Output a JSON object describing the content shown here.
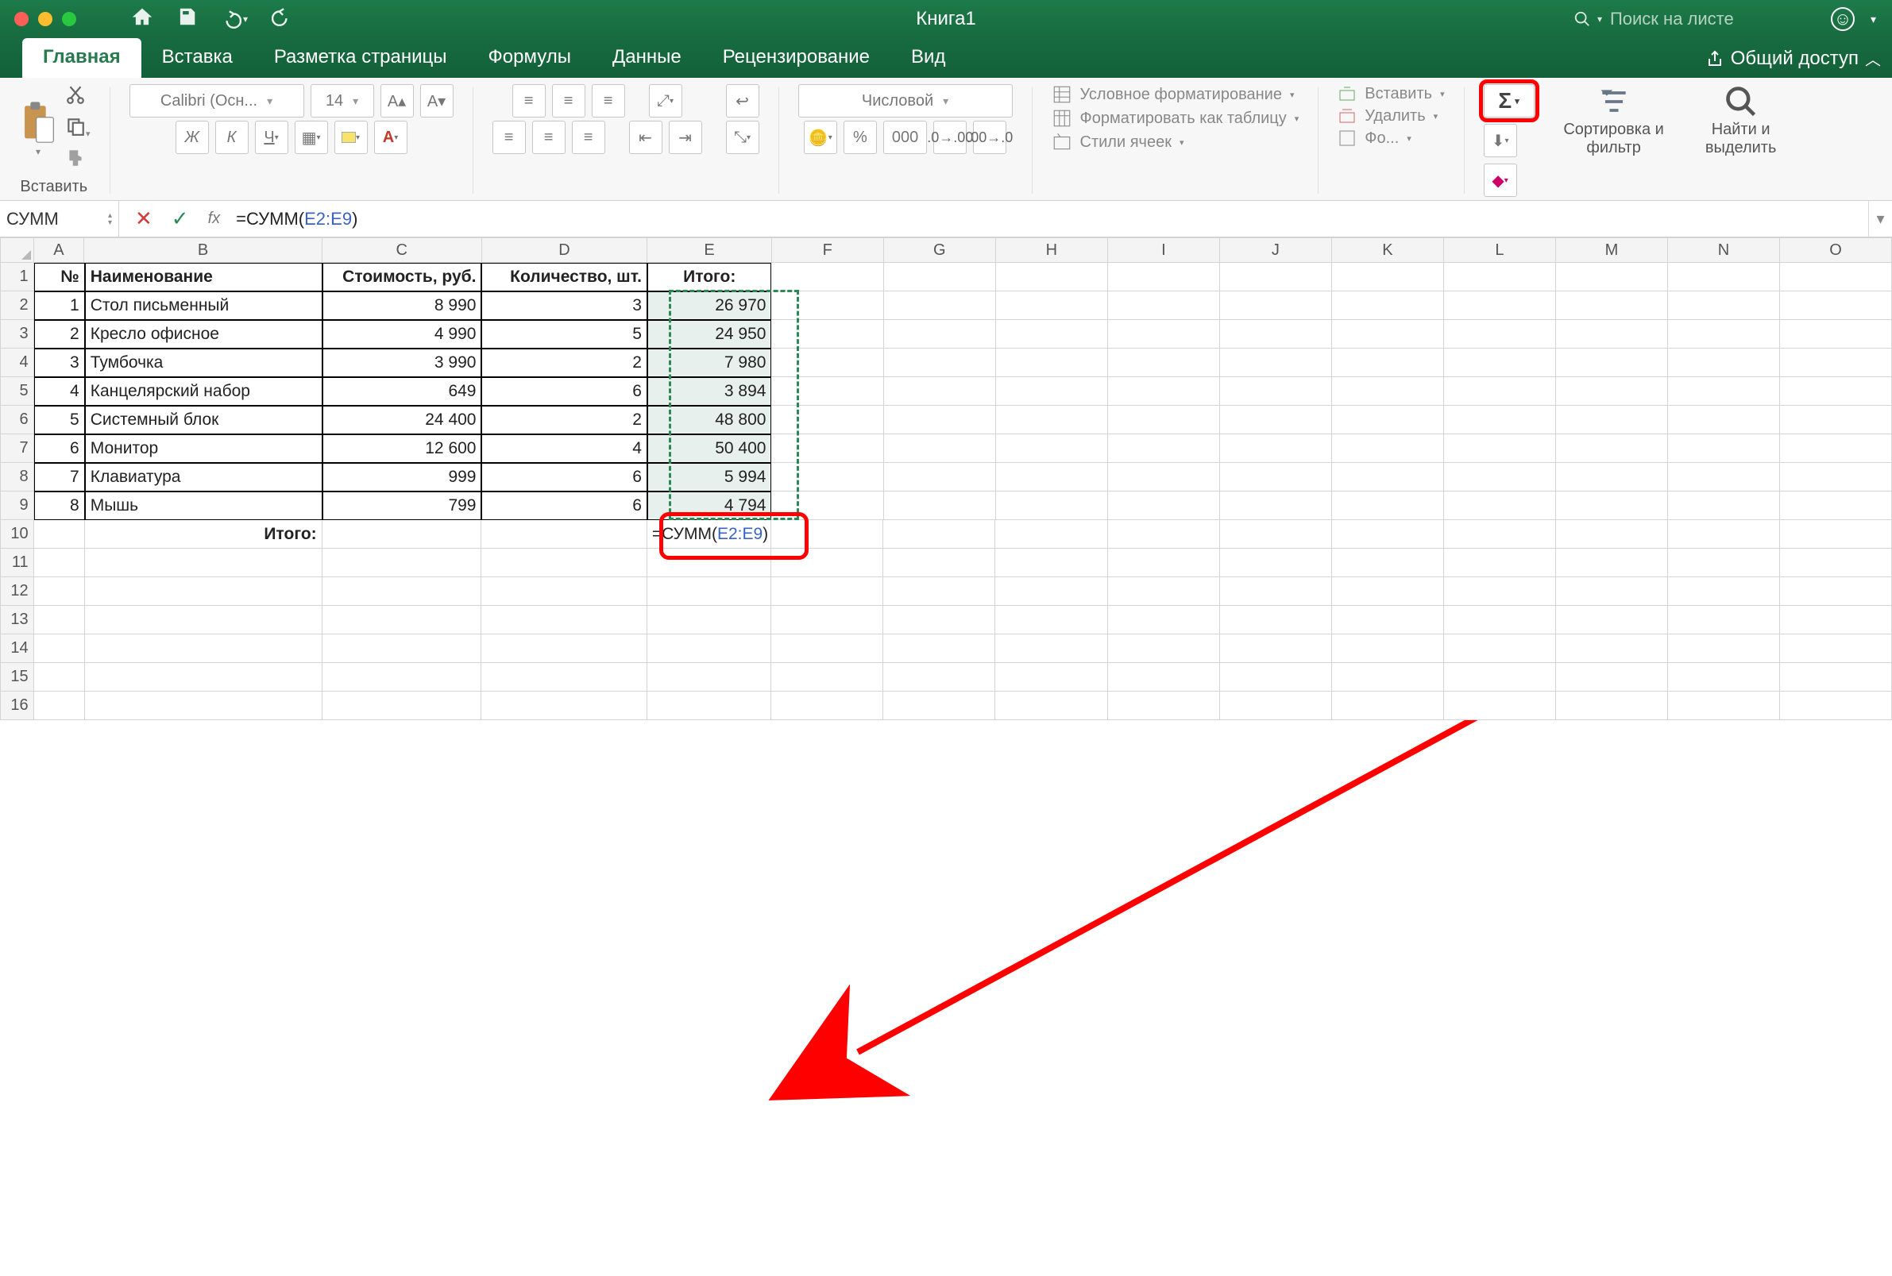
{
  "titlebar": {
    "title": "Книга1",
    "search_placeholder": "Поиск на листе"
  },
  "tabs": {
    "items": [
      "Главная",
      "Вставка",
      "Разметка страницы",
      "Формулы",
      "Данные",
      "Рецензирование",
      "Вид"
    ],
    "active": 0,
    "share": "Общий доступ"
  },
  "ribbon": {
    "paste": "Вставить",
    "font_name": "Calibri (Осн...",
    "font_size": "14",
    "number_format": "Числовой",
    "cond_fmt": "Условное форматирование",
    "fmt_table": "Форматировать как таблицу",
    "cell_styles": "Стили ячеек",
    "insert": "Вставить",
    "delete": "Удалить",
    "format": "Фо...",
    "sort": "Сортировка и фильтр",
    "find": "Найти и выделить",
    "autosum": "Σ"
  },
  "formula_bar": {
    "name_box": "СУММ",
    "formula_prefix": "=СУММ(",
    "formula_range": "E2:E9",
    "formula_suffix": ")"
  },
  "columns": [
    "A",
    "B",
    "C",
    "D",
    "E",
    "F",
    "G",
    "H",
    "I",
    "J",
    "K",
    "L",
    "M",
    "N",
    "O"
  ],
  "col_widths": [
    "cA",
    "cB",
    "cC",
    "cD",
    "cE",
    "cRest",
    "cRest",
    "cRest",
    "cRest",
    "cRest",
    "cRest",
    "cRest",
    "cRest",
    "cRest",
    "cRest"
  ],
  "headers": {
    "num": "№",
    "name": "Наименование",
    "cost": "Стоимость, руб.",
    "qty": "Количество, шт.",
    "total": "Итого:"
  },
  "rows": [
    {
      "n": "1",
      "name": "Стол письменный",
      "cost": "8 990",
      "qty": "3",
      "total": "26 970"
    },
    {
      "n": "2",
      "name": "Кресло офисное",
      "cost": "4 990",
      "qty": "5",
      "total": "24 950"
    },
    {
      "n": "3",
      "name": "Тумбочка",
      "cost": "3 990",
      "qty": "2",
      "total": "7 980"
    },
    {
      "n": "4",
      "name": "Канцелярский набор",
      "cost": "649",
      "qty": "6",
      "total": "3 894"
    },
    {
      "n": "5",
      "name": "Системный блок",
      "cost": "24 400",
      "qty": "2",
      "total": "48 800"
    },
    {
      "n": "6",
      "name": "Монитор",
      "cost": "12 600",
      "qty": "4",
      "total": "50 400"
    },
    {
      "n": "7",
      "name": "Клавиатура",
      "cost": "999",
      "qty": "6",
      "total": "5 994"
    },
    {
      "n": "8",
      "name": "Мышь",
      "cost": "799",
      "qty": "6",
      "total": "4 794"
    }
  ],
  "footer": {
    "label": "Итого:",
    "cell_prefix": "=СУММ(",
    "cell_range": "E2:E9",
    "cell_suffix": ")"
  },
  "visible_row_count": 16
}
